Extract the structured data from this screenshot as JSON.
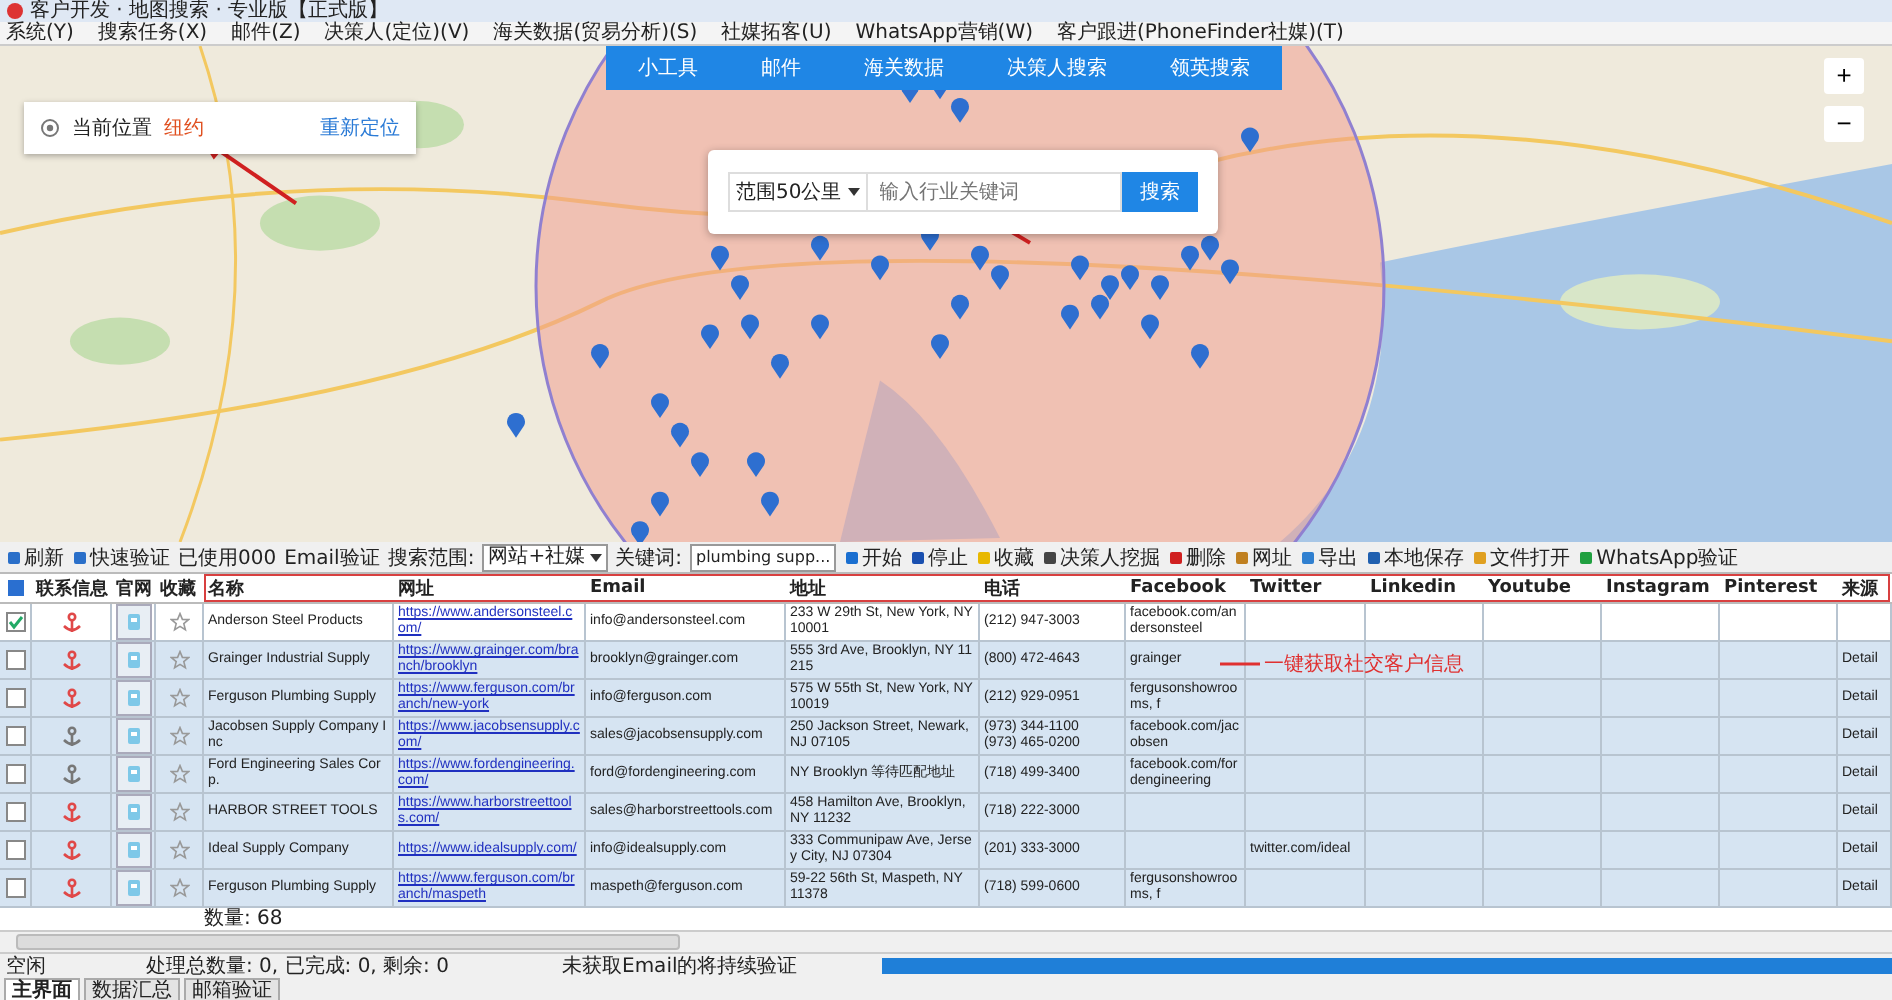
{
  "window": {
    "title": "客户开发 · 地图搜索 · 专业版【正式版】"
  },
  "menu": [
    "系统(Y)",
    "搜索任务(X)",
    "邮件(Z)",
    "决策人(定位)(V)",
    "海关数据(贸易分析)(S)",
    "社媒拓客(U)",
    "WhatsApp营销(W)",
    "客户跟进(PhoneFinder社媒)(T)"
  ],
  "map": {
    "location": {
      "label": "当前位置",
      "city": "纽约",
      "action": "重新定位"
    },
    "nav_tabs": [
      "小工具",
      "邮件",
      "海关数据",
      "决策人搜索",
      "领英搜索"
    ],
    "search": {
      "range": "范围50公里",
      "placeholder": "输入行业关键词",
      "button": "搜索"
    },
    "zoom": {
      "in": "+",
      "out": "−"
    }
  },
  "toolbar": [
    {
      "kind": "button",
      "label": "刷新"
    },
    {
      "kind": "button",
      "label": "快速验证"
    },
    {
      "kind": "text",
      "label": "已使用000"
    },
    {
      "kind": "text",
      "label": "Email验证"
    },
    {
      "kind": "text",
      "label": "搜索范围:"
    },
    {
      "kind": "select",
      "label": "网站+社媒"
    },
    {
      "kind": "text",
      "label": "关键词:"
    },
    {
      "kind": "input",
      "label": "plumbing supp..."
    },
    {
      "kind": "button",
      "label": "开始"
    },
    {
      "kind": "button",
      "label": "停止"
    },
    {
      "kind": "button",
      "label": "收藏"
    },
    {
      "kind": "button",
      "label": "决策人挖掘"
    },
    {
      "kind": "button",
      "label": "删除"
    },
    {
      "kind": "button",
      "label": "网址"
    },
    {
      "kind": "button",
      "label": "导出"
    },
    {
      "kind": "button",
      "label": "本地保存"
    },
    {
      "kind": "button",
      "label": "文件打开"
    },
    {
      "kind": "button",
      "label": "WhatsApp验证"
    }
  ],
  "table": {
    "select_all_partial": true,
    "columns": [
      "联系信息",
      "官网",
      "收藏",
      "名称",
      "网址",
      "Email",
      "地址",
      "电话",
      "Facebook",
      "Twitter",
      "Linkedin",
      "Youtube",
      "Instagram",
      "Pinterest",
      "来源"
    ],
    "rows": [
      {
        "checked": true,
        "selected": true,
        "contact_found": true,
        "name": "Anderson Steel Products",
        "website": "https://www.andersonsteel.com/",
        "email": "info@andersonsteel.com",
        "address": "233 W 29th St, New York, NY 10001",
        "phones": [
          "(212) 947-3003"
        ],
        "facebook": "facebook.com/andersonsteel",
        "twitter": "",
        "source": ""
      },
      {
        "checked": false,
        "selected": false,
        "contact_found": true,
        "name": "Grainger Industrial Supply",
        "website": "https://www.grainger.com/branch/brooklyn",
        "email": "brooklyn@grainger.com",
        "address": "555 3rd Ave, Brooklyn, NY 11215",
        "phones": [
          "(800) 472-4643"
        ],
        "facebook": "grainger",
        "twitter": "",
        "source": "Detail"
      },
      {
        "checked": false,
        "selected": false,
        "contact_found": true,
        "name": "Ferguson Plumbing Supply",
        "website": "https://www.ferguson.com/branch/new-york",
        "email": "info@ferguson.com",
        "address": "575 W 55th St, New York, NY 10019",
        "phones": [
          "(212) 929-0951"
        ],
        "facebook": "fergusonshowrooms, f",
        "twitter": "",
        "source": "Detail"
      },
      {
        "checked": false,
        "selected": false,
        "contact_found": false,
        "name": "Jacobsen Supply Company Inc",
        "website": "https://www.jacobsensupply.com/",
        "email": "sales@jacobsensupply.com",
        "address": "250 Jackson Street, Newark, NJ 07105",
        "phones": [
          "(973) 344-1100",
          "(973) 465-0200"
        ],
        "facebook": "facebook.com/jacobsen",
        "twitter": "",
        "source": "Detail"
      },
      {
        "checked": false,
        "selected": false,
        "contact_found": false,
        "name": "Ford Engineering Sales Corp.",
        "website": "https://www.fordengineering.com/",
        "email": "ford@fordengineering.com",
        "address": "NY Brooklyn 等待匹配地址",
        "phones": [
          "(718) 499-3400"
        ],
        "facebook": "facebook.com/fordengineering",
        "twitter": "",
        "source": "Detail"
      },
      {
        "checked": false,
        "selected": false,
        "contact_found": true,
        "name": "HARBOR STREET TOOLS",
        "website": "https://www.harborstreettools.com/",
        "email": "sales@harborstreettools.com",
        "address": "458 Hamilton Ave, Brooklyn, NY 11232",
        "phones": [
          "(718) 222-3000"
        ],
        "facebook": "",
        "twitter": "",
        "source": "Detail"
      },
      {
        "checked": false,
        "selected": false,
        "contact_found": true,
        "name": "Ideal Supply Company",
        "website": "https://www.idealsupply.com/",
        "email": "info@idealsupply.com",
        "address": "333 Communipaw Ave, Jersey City, NJ 07304",
        "phones": [
          "(201) 333-3000"
        ],
        "facebook": "",
        "twitter": "twitter.com/ideal",
        "source": "Detail"
      },
      {
        "checked": false,
        "selected": false,
        "contact_found": true,
        "name": "Ferguson Plumbing Supply",
        "website": "https://www.ferguson.com/branch/maspeth",
        "email": "maspeth@ferguson.com",
        "address": "59-22 56th St, Maspeth, NY 11378",
        "phones": [
          "(718) 599-0600"
        ],
        "facebook": "fergusonshowrooms, f",
        "twitter": "",
        "source": "Detail"
      }
    ],
    "count": "数量: 68"
  },
  "callout": "一键获取社交客户信息",
  "status_bar": {
    "state": "空闲",
    "progress_text": "处理总数量: 0, 已完成: 0, 剩余: 0",
    "message": "未获取Email的将持续验证",
    "level": 1
  },
  "bottom_tabs": [
    {
      "label": "主界面",
      "selected": true
    },
    {
      "label": "数据汇总",
      "selected": false
    },
    {
      "label": "邮箱验证",
      "selected": false
    }
  ]
}
